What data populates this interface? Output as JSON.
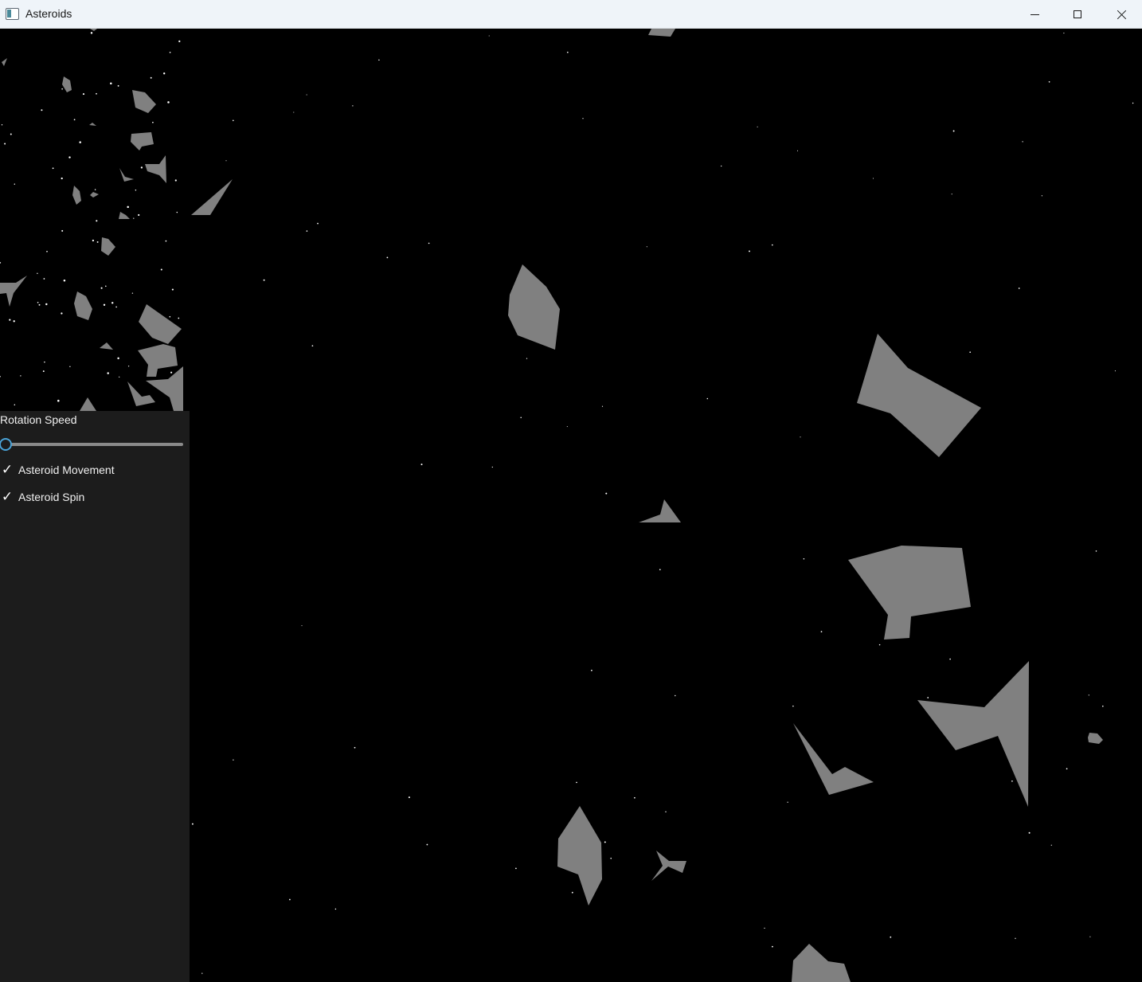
{
  "window": {
    "title": "Asteroids",
    "icon": "app-window-icon",
    "controls": {
      "minimize": "minimize-icon",
      "maximize": "maximize-icon",
      "close": "close-icon"
    }
  },
  "controls_panel": {
    "rotation_speed": {
      "label": "Rotation Speed",
      "value": 0,
      "accent_color": "#4aa3d8"
    },
    "asteroid_movement": {
      "label": "Asteroid Movement",
      "checked": true,
      "check_glyph": "✓"
    },
    "asteroid_spin": {
      "label": "Asteroid Spin",
      "checked": true,
      "check_glyph": "✓"
    }
  },
  "scene": {
    "background_color": "#000000",
    "asteroid_color": "#808080",
    "star_color": "#ffffff"
  }
}
